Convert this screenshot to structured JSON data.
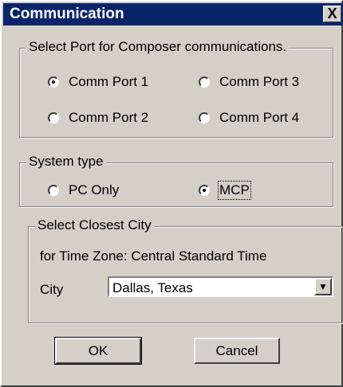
{
  "window": {
    "title": "Communication",
    "close_label": "X"
  },
  "port_group": {
    "legend": "Select Port for Composer communications.",
    "options": [
      {
        "label": "Comm Port 1",
        "checked": true
      },
      {
        "label": "Comm Port 3",
        "checked": false
      },
      {
        "label": "Comm Port 2",
        "checked": false
      },
      {
        "label": "Comm Port 4",
        "checked": false
      }
    ]
  },
  "system_group": {
    "legend": "System type",
    "options": [
      {
        "label": "PC Only",
        "checked": false
      },
      {
        "label": "MCP",
        "checked": true
      }
    ]
  },
  "city_group": {
    "legend": "Select Closest City",
    "timezone_text": "for Time Zone: Central Standard Time",
    "city_label": "City",
    "city_value": "Dallas, Texas"
  },
  "buttons": {
    "ok": "OK",
    "cancel": "Cancel"
  }
}
